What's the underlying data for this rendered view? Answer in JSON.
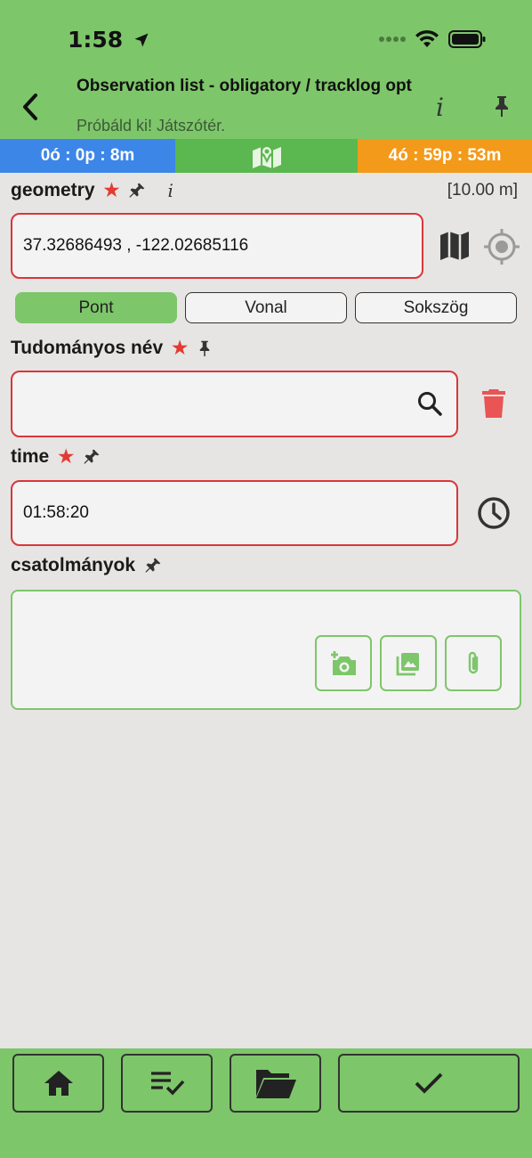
{
  "status_bar": {
    "time": "1:58"
  },
  "header": {
    "title": "Observation list - obligatory / tracklog opt",
    "subtitle": "Próbáld ki! Játszótér.",
    "background": "#7dc66a"
  },
  "timebar": {
    "left": "0ó : 0p : 8m",
    "right": "4ó : 59p : 53m",
    "left_color": "#3c86e8",
    "mid_color": "#5bb74f",
    "right_color": "#f39a1a"
  },
  "geometry": {
    "label": "geometry",
    "info": "i",
    "accuracy": "[10.00 m]",
    "value": "37.32686493 , -122.02685116",
    "segments": [
      "Pont",
      "Vonal",
      "Sokszög"
    ],
    "selected_segment": "Pont"
  },
  "species": {
    "label": "Tudományos név",
    "value": ""
  },
  "time": {
    "label": "time",
    "value": "01:58:20"
  },
  "attachments": {
    "label": "csatolmányok"
  },
  "icons": {
    "back": "chevron-left-icon",
    "location": "location-arrow-icon",
    "map": "map-icon",
    "gps": "crosshair-icon",
    "search": "search-icon",
    "trash": "trash-icon",
    "clock": "clock-icon",
    "add_photo": "add-photo-icon",
    "gallery": "gallery-icon",
    "paperclip": "paperclip-icon",
    "home": "home-icon",
    "checklist": "checklist-icon",
    "folder": "folder-open-icon",
    "check": "check-icon"
  },
  "colors": {
    "required": "#e23b33",
    "error_border": "#d9363a",
    "accent": "#7dc66a"
  }
}
